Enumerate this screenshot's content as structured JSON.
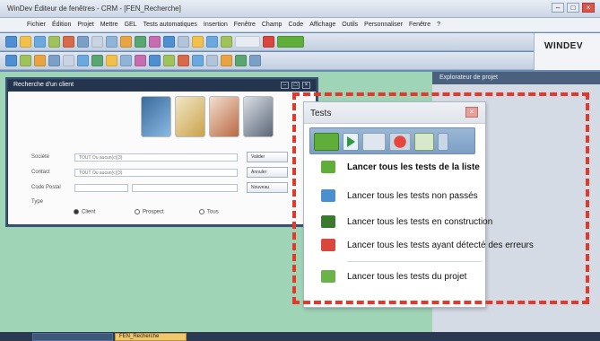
{
  "window": {
    "title": "WinDev   Éditeur de fenêtres - CRM - [FEN_Recherche]"
  },
  "menu": [
    "Fichier",
    "Édition",
    "Projet",
    "Mettre",
    "GEL",
    "Tests automatiques",
    "Insertion",
    "Fenêtre",
    "Champ",
    "Code",
    "Affichage",
    "Outils",
    "Personnaliser",
    "Fenêtre",
    "?"
  ],
  "brand": "WINDEV",
  "right_panel": {
    "title": "Explorateur de projet"
  },
  "form": {
    "title": "Recherche d'un client",
    "fields": [
      {
        "label": "Société",
        "value": "TOUT Ou aucun(c)(3)",
        "button": "Valider"
      },
      {
        "label": "Contact",
        "value": "TOUT Ou aucun(c)(3)",
        "button": "Annuler"
      },
      {
        "label": "Code Postal",
        "value": "",
        "button": "Nouveau"
      }
    ],
    "type_label": "Type",
    "radios": [
      {
        "label": "Client",
        "selected": true
      },
      {
        "label": "Prospect",
        "selected": false
      },
      {
        "label": "Tous",
        "selected": false
      }
    ]
  },
  "popup": {
    "title": "Tests",
    "items": [
      {
        "label": "Lancer tous les tests de la liste",
        "bold": true,
        "icon": "run-list-icon",
        "color": "#5fae3a"
      },
      {
        "label": "Lancer tous les tests non passés",
        "bold": false,
        "icon": "run-notpassed-icon",
        "color": "#4a8fd0"
      },
      {
        "label": "Lancer tous les tests en construction",
        "bold": false,
        "icon": "run-construction-icon",
        "color": "#3b7a2e"
      },
      {
        "label": "Lancer tous les tests ayant détecté des erreurs",
        "bold": false,
        "icon": "run-errors-icon",
        "color": "#d9463d"
      },
      {
        "label": "Lancer tous les tests du projet",
        "bold": false,
        "icon": "run-project-icon",
        "color": "#6cb24a"
      }
    ]
  },
  "taskbar": {
    "active_tab": "FEN_Recherche"
  },
  "colors": {
    "highlight": "#e5382b",
    "workspace": "#9fd4b6",
    "titlebar": "#25354e"
  }
}
